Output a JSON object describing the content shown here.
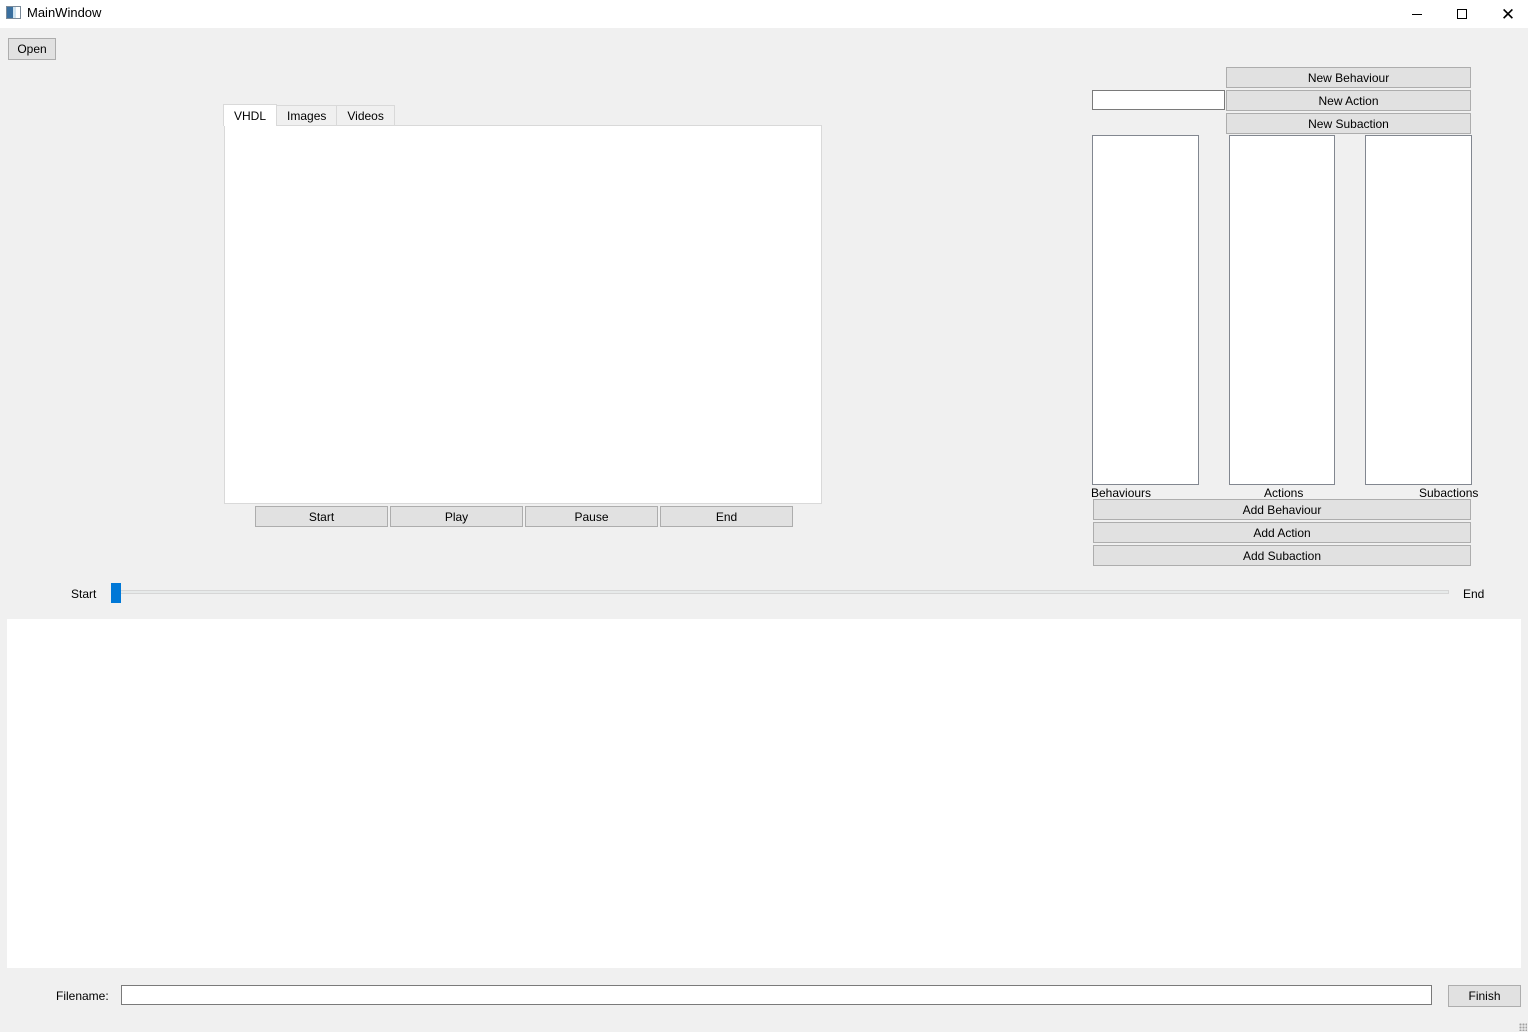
{
  "window": {
    "title": "MainWindow",
    "controls": {
      "minimize": "minimize",
      "maximize": "maximize",
      "close": "✕"
    }
  },
  "toolbar": {
    "open_label": "Open"
  },
  "tabs": [
    {
      "label": "VHDL",
      "active": true
    },
    {
      "label": "Images",
      "active": false
    },
    {
      "label": "Videos",
      "active": false
    }
  ],
  "playback": {
    "start_label": "Start",
    "play_label": "Play",
    "pause_label": "Pause",
    "end_label": "End"
  },
  "editor": {
    "name_input_value": "",
    "new_behaviour_label": "New Behaviour",
    "new_action_label": "New Action",
    "new_subaction_label": "New Subaction",
    "lists": {
      "behaviours_label": "Behaviours",
      "actions_label": "Actions",
      "subactions_label": "Subactions",
      "behaviours_items": [],
      "actions_items": [],
      "subactions_items": []
    },
    "add_behaviour_label": "Add Behaviour",
    "add_action_label": "Add Action",
    "add_subaction_label": "Add Subaction"
  },
  "timeline": {
    "start_label": "Start",
    "end_label": "End",
    "position_fraction": 0.0
  },
  "footer": {
    "filename_label": "Filename:",
    "filename_value": "",
    "finish_label": "Finish"
  }
}
